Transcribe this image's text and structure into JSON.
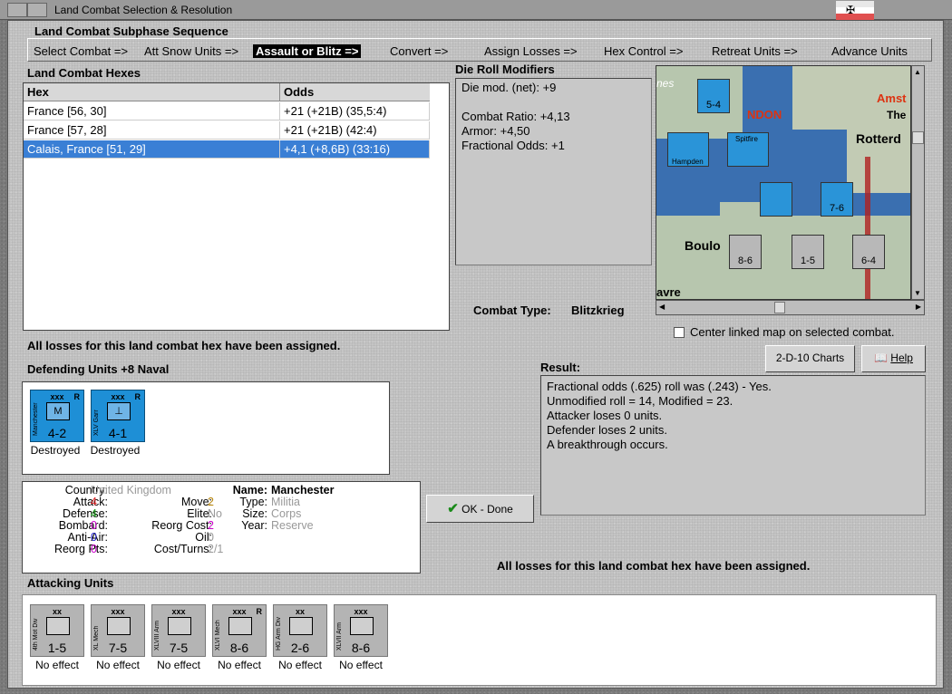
{
  "window": {
    "title": "Land Combat Selection & Resolution"
  },
  "sequence": {
    "header": "Land Combat Subphase Sequence",
    "steps": [
      "Select Combat =>",
      "Att Snow Units =>",
      "Assault or Blitz =>",
      "Convert =>",
      "Assign Losses =>",
      "Hex Control =>",
      "Retreat Units =>",
      "Advance Units"
    ],
    "active_index": 2
  },
  "hexes": {
    "header": "Land Combat Hexes",
    "columns": [
      "Hex",
      "Odds"
    ],
    "rows": [
      {
        "hex": "France [56, 30]",
        "odds": "+21 (+21B) (35,5:4)"
      },
      {
        "hex": "France [57, 28]",
        "odds": "+21 (+21B) (42:4)"
      },
      {
        "hex": "Calais, France [51, 29]",
        "odds": "+4,1 (+8,6B) (33:16)"
      }
    ],
    "selected_index": 2
  },
  "die_roll": {
    "header": "Die Roll Modifiers",
    "lines": [
      "Die mod. (net): +9",
      "",
      "Combat Ratio: +4,13",
      "Armor: +4,50",
      "Fractional Odds: +1"
    ]
  },
  "combat_type": {
    "label": "Combat Type:",
    "value": "Blitzkrieg"
  },
  "losses_assigned_msg": "All losses for this land combat hex have been assigned.",
  "center_map": {
    "label": "Center linked map on selected combat.",
    "checked": false
  },
  "buttons": {
    "charts": "2-D-10 Charts",
    "help": "Help",
    "ok": "OK - Done"
  },
  "result": {
    "header": "Result:",
    "lines": [
      "Fractional odds (.625) roll was (.243)  - Yes.",
      "Unmodified roll = 14, Modified = 23.",
      "Attacker loses 0 units.",
      "Defender loses 2 units.",
      "A breakthrough occurs."
    ]
  },
  "defending": {
    "header": "Defending Units +8 Naval",
    "units": [
      {
        "size": "xxx",
        "tag": "R",
        "side": "Manchester",
        "sym": "M",
        "strength": "4-2",
        "status": "Destroyed"
      },
      {
        "size": "xxx",
        "tag": "R",
        "side": "XLV Garr",
        "sym": "",
        "strength": "4-1",
        "status": "Destroyed"
      }
    ]
  },
  "unit_info": {
    "country_label": "Country:",
    "country": "United Kingdom",
    "name_label": "Name:",
    "name": "Manchester",
    "attack_label": "Attack:",
    "attack": "4",
    "defense_label": "Defense:",
    "defense": "4",
    "bombard_label": "Bombard:",
    "bombard": "0",
    "antiair_label": "Anti-Air:",
    "antiair": "0",
    "reorgpts_label": "Reorg Pts:",
    "reorgpts": "0",
    "move_label": "Move:",
    "move": "2",
    "elite_label": "Elite:",
    "elite": "No",
    "reorgcost_label": "Reorg Cost:",
    "reorgcost": "2",
    "oil_label": "Oil:",
    "oil": "0",
    "costturns_label": "Cost/Turns:",
    "costturns": "2/1",
    "type_label": "Type:",
    "type": "Militia",
    "sizeu_label": "Size:",
    "sizeu": "Corps",
    "year_label": "Year:",
    "year": "Reserve"
  },
  "attacking": {
    "header": "Attacking Units",
    "units": [
      {
        "size": "xx",
        "tag": "",
        "side": "4th Mot Div",
        "strength": "1-5",
        "status": "No effect"
      },
      {
        "size": "xxx",
        "tag": "",
        "side": "XL Mech",
        "strength": "7-5",
        "status": "No effect"
      },
      {
        "size": "xxx",
        "tag": "",
        "side": "XLVIII Arm",
        "strength": "7-5",
        "status": "No effect"
      },
      {
        "size": "xxx",
        "tag": "R",
        "side": "XLVI Mech",
        "strength": "8-6",
        "status": "No effect"
      },
      {
        "size": "xx",
        "tag": "",
        "side": "HG Arm Div",
        "strength": "2-6",
        "status": "No effect"
      },
      {
        "size": "xxx",
        "tag": "",
        "side": "XLVII Arm",
        "strength": "8-6",
        "status": "No effect"
      }
    ]
  },
  "map": {
    "labels": [
      "nes",
      "NDON",
      "Amst",
      "The",
      "Rotterd",
      "Boulo",
      "avre"
    ],
    "counters": [
      {
        "strength": "5-4",
        "size": "xxx"
      },
      {
        "strength": "7-6",
        "size": "xxx"
      },
      {
        "strength": "8-6",
        "size": "xxx"
      },
      {
        "strength": "1-5",
        "size": "xx"
      },
      {
        "strength": "6-4",
        "size": "xxx"
      }
    ],
    "aircraft": [
      "Hampden",
      "Spitfire"
    ]
  }
}
